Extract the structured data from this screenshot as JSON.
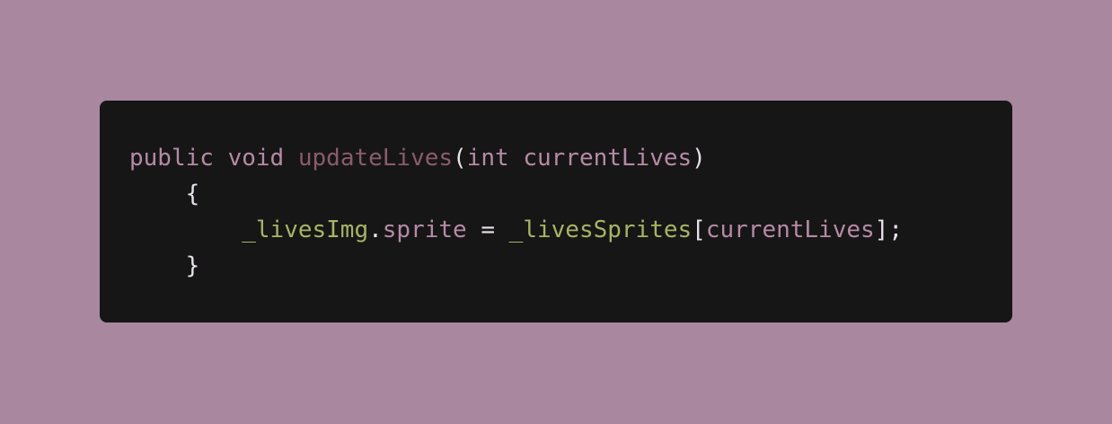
{
  "colors": {
    "background": "#a9879f",
    "code_background": "#161616",
    "keyword": "#b68aa6",
    "method": "#8a5b6d",
    "punctuation": "#e8e1ea",
    "field": "#a8b365",
    "member": "#b68aa6"
  },
  "code": {
    "lines": [
      [
        {
          "text": "public",
          "kind": "keyword"
        },
        {
          "text": " ",
          "kind": "plain"
        },
        {
          "text": "void",
          "kind": "keyword"
        },
        {
          "text": " ",
          "kind": "plain"
        },
        {
          "text": "updateLives",
          "kind": "method"
        },
        {
          "text": "(",
          "kind": "punctuation"
        },
        {
          "text": "int",
          "kind": "keyword"
        },
        {
          "text": " ",
          "kind": "plain"
        },
        {
          "text": "currentLives",
          "kind": "keyword"
        },
        {
          "text": ")",
          "kind": "punctuation"
        }
      ],
      [
        {
          "text": "    ",
          "kind": "plain"
        },
        {
          "text": "{",
          "kind": "punctuation"
        }
      ],
      [
        {
          "text": "        ",
          "kind": "plain"
        },
        {
          "text": "_livesImg",
          "kind": "field"
        },
        {
          "text": ".",
          "kind": "punctuation"
        },
        {
          "text": "sprite",
          "kind": "member"
        },
        {
          "text": " = ",
          "kind": "punctuation"
        },
        {
          "text": "_livesSprites",
          "kind": "field"
        },
        {
          "text": "[",
          "kind": "punctuation"
        },
        {
          "text": "currentLives",
          "kind": "member"
        },
        {
          "text": "];",
          "kind": "punctuation"
        }
      ],
      [
        {
          "text": "    ",
          "kind": "plain"
        },
        {
          "text": "}",
          "kind": "punctuation"
        }
      ]
    ]
  }
}
